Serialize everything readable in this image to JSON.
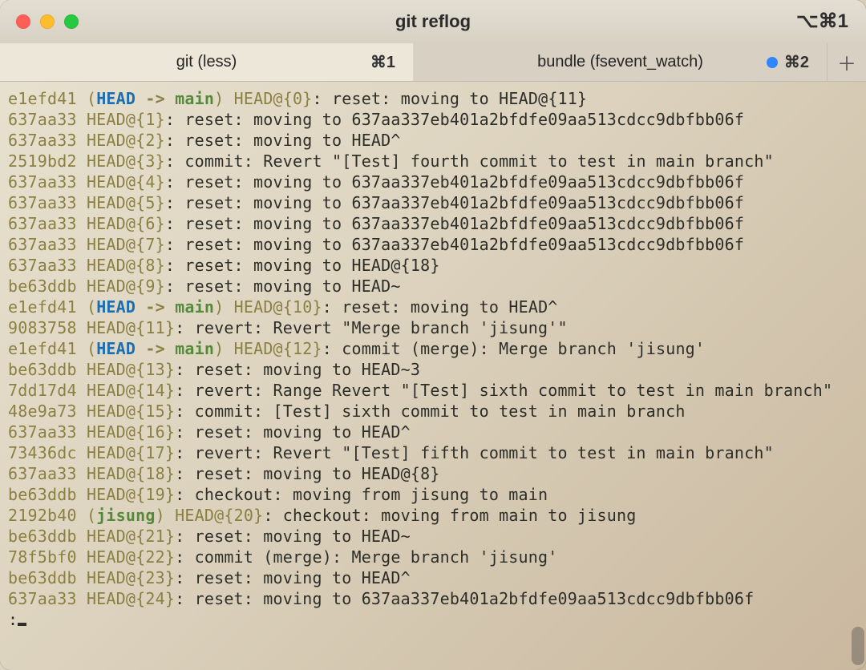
{
  "window": {
    "title": "git reflog",
    "shortcut": "⌥⌘1"
  },
  "tabs": {
    "active_index": 0,
    "items": [
      {
        "label": "git (less)",
        "keys": "⌘1"
      },
      {
        "label": "bundle (fsevent_watch)",
        "keys": "⌘2",
        "has_activity": true
      }
    ],
    "add_icon": "＋"
  },
  "reflog": [
    {
      "hash": "e1efd41",
      "head_main": true,
      "ref": "HEAD@{0}",
      "msg": "reset: moving to HEAD@{11}"
    },
    {
      "hash": "637aa33",
      "ref": "HEAD@{1}",
      "msg": "reset: moving to 637aa337eb401a2bfdfe09aa513cdcc9dbfbb06f"
    },
    {
      "hash": "637aa33",
      "ref": "HEAD@{2}",
      "msg": "reset: moving to HEAD^"
    },
    {
      "hash": "2519bd2",
      "ref": "HEAD@{3}",
      "msg": "commit: Revert \"[Test] fourth commit to test in main branch\""
    },
    {
      "hash": "637aa33",
      "ref": "HEAD@{4}",
      "msg": "reset: moving to 637aa337eb401a2bfdfe09aa513cdcc9dbfbb06f"
    },
    {
      "hash": "637aa33",
      "ref": "HEAD@{5}",
      "msg": "reset: moving to 637aa337eb401a2bfdfe09aa513cdcc9dbfbb06f"
    },
    {
      "hash": "637aa33",
      "ref": "HEAD@{6}",
      "msg": "reset: moving to 637aa337eb401a2bfdfe09aa513cdcc9dbfbb06f"
    },
    {
      "hash": "637aa33",
      "ref": "HEAD@{7}",
      "msg": "reset: moving to 637aa337eb401a2bfdfe09aa513cdcc9dbfbb06f"
    },
    {
      "hash": "637aa33",
      "ref": "HEAD@{8}",
      "msg": "reset: moving to HEAD@{18}"
    },
    {
      "hash": "be63ddb",
      "ref": "HEAD@{9}",
      "msg": "reset: moving to HEAD~"
    },
    {
      "hash": "e1efd41",
      "head_main": true,
      "ref": "HEAD@{10}",
      "msg": "reset: moving to HEAD^"
    },
    {
      "hash": "9083758",
      "ref": "HEAD@{11}",
      "msg": "revert: Revert \"Merge branch 'jisung'\""
    },
    {
      "hash": "e1efd41",
      "head_main": true,
      "ref": "HEAD@{12}",
      "msg": "commit (merge): Merge branch 'jisung'"
    },
    {
      "hash": "be63ddb",
      "ref": "HEAD@{13}",
      "msg": "reset: moving to HEAD~3"
    },
    {
      "hash": "7dd17d4",
      "ref": "HEAD@{14}",
      "msg": "revert: Range Revert \"[Test] sixth commit to test in main branch\""
    },
    {
      "hash": "48e9a73",
      "ref": "HEAD@{15}",
      "msg": "commit: [Test] sixth commit to test in main branch"
    },
    {
      "hash": "637aa33",
      "ref": "HEAD@{16}",
      "msg": "reset: moving to HEAD^"
    },
    {
      "hash": "73436dc",
      "ref": "HEAD@{17}",
      "msg": "revert: Revert \"[Test] fifth commit to test in main branch\""
    },
    {
      "hash": "637aa33",
      "ref": "HEAD@{18}",
      "msg": "reset: moving to HEAD@{8}"
    },
    {
      "hash": "be63ddb",
      "ref": "HEAD@{19}",
      "msg": "checkout: moving from jisung to main"
    },
    {
      "hash": "2192b40",
      "branch_only": "jisung",
      "ref": "HEAD@{20}",
      "msg": "checkout: moving from main to jisung"
    },
    {
      "hash": "be63ddb",
      "ref": "HEAD@{21}",
      "msg": "reset: moving to HEAD~"
    },
    {
      "hash": "78f5bf0",
      "ref": "HEAD@{22}",
      "msg": "commit (merge): Merge branch 'jisung'"
    },
    {
      "hash": "be63ddb",
      "ref": "HEAD@{23}",
      "msg": "reset: moving to HEAD^"
    },
    {
      "hash": "637aa33",
      "ref": "HEAD@{24}",
      "msg": "reset: moving to 637aa337eb401a2bfdfe09aa513cdcc9dbfbb06f"
    }
  ],
  "tokens": {
    "head": "HEAD",
    "arrow": " -> ",
    "main_branch": "main"
  },
  "prompt": ":"
}
